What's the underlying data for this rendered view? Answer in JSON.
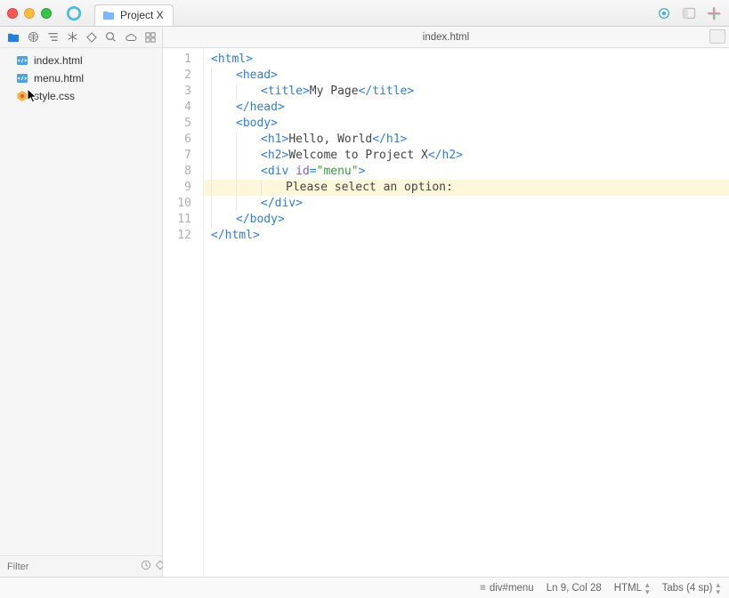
{
  "window": {
    "project_tab_label": "Project X"
  },
  "sidebar": {
    "files": [
      {
        "name": "index.html",
        "kind": "html"
      },
      {
        "name": "menu.html",
        "kind": "html"
      },
      {
        "name": "style.css",
        "kind": "css"
      }
    ],
    "filter_placeholder": "Filter"
  },
  "editor": {
    "tab_title": "index.html",
    "lines": [
      {
        "n": 1,
        "indent": 0,
        "html": "<span class='tag'>&lt;html&gt;</span>"
      },
      {
        "n": 2,
        "indent": 1,
        "html": "<span class='tag'>&lt;head&gt;</span>"
      },
      {
        "n": 3,
        "indent": 2,
        "html": "<span class='tag'>&lt;title&gt;</span><span class='txt'>My Page</span><span class='tag'>&lt;/title&gt;</span>"
      },
      {
        "n": 4,
        "indent": 1,
        "html": "<span class='tag'>&lt;/head&gt;</span>"
      },
      {
        "n": 5,
        "indent": 1,
        "html": "<span class='tag'>&lt;body&gt;</span>"
      },
      {
        "n": 6,
        "indent": 2,
        "html": "<span class='tag'>&lt;h1&gt;</span><span class='txt'>Hello, World</span><span class='tag'>&lt;/h1&gt;</span>"
      },
      {
        "n": 7,
        "indent": 2,
        "html": "<span class='tag'>&lt;h2&gt;</span><span class='txt'>Welcome to Project X</span><span class='tag'>&lt;/h2&gt;</span>"
      },
      {
        "n": 8,
        "indent": 2,
        "html": "<span class='tag'>&lt;div </span><span class='attr'>id</span><span class='tag'>=</span><span class='str'>&quot;menu&quot;</span><span class='tag'>&gt;</span>"
      },
      {
        "n": 9,
        "indent": 3,
        "hl": true,
        "html": "<span class='txt'>Please select an option:</span>"
      },
      {
        "n": 10,
        "indent": 2,
        "html": "<span class='tag'>&lt;/div&gt;</span>"
      },
      {
        "n": 11,
        "indent": 1,
        "html": "<span class='tag'>&lt;/body&gt;</span>"
      },
      {
        "n": 12,
        "indent": 0,
        "html": "<span class='tag'>&lt;/html&gt;</span>"
      }
    ]
  },
  "status": {
    "breadcrumb_icon": "≡",
    "breadcrumb": "div#menu",
    "position": "Ln 9, Col 28",
    "language": "HTML",
    "indent": "Tabs (4 sp)"
  }
}
